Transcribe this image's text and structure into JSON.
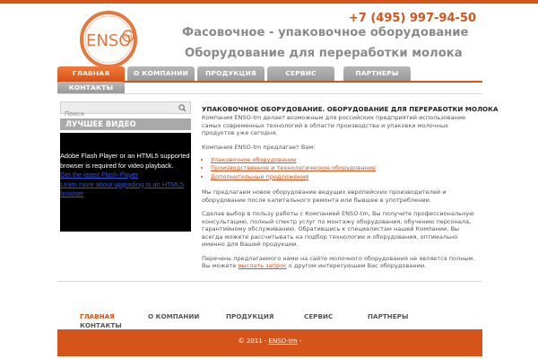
{
  "brand": {
    "logo_text": "ENSO",
    "logo_badge": "tm",
    "accent": "#d4541a"
  },
  "header": {
    "phone": "+7 (495) 997-94-50",
    "title_line1": "Фасовочное - упаковочное оборудование",
    "title_line2": "Оборудование для переработки молока"
  },
  "nav": {
    "tabs": [
      {
        "label": "Главная",
        "active": true
      },
      {
        "label": "О компании",
        "active": false
      },
      {
        "label": "Продукция",
        "active": false
      },
      {
        "label": "Сервис",
        "active": false
      },
      {
        "label": "Партнеры",
        "active": false
      },
      {
        "label": "Контакты",
        "active": false
      }
    ]
  },
  "sidebar": {
    "search_placeholder": "Поиск",
    "video_heading": "Лучшее видео",
    "video_message": "Adobe Flash Player or an HTML5 supported browser is required for video playback.",
    "video_link1": "Get the latest Flash Player",
    "video_link2": "Learn more about upgrading to an HTML5 browser"
  },
  "content": {
    "heading": "Упаковочное оборудование. Оборудование для переработки молока",
    "p1": "Компания ENSO-tm делает возможным для российских предприятий использование самых современных технологий в области производства и упаковки молочных продуктов уже сегодня.",
    "p2": "Компания ENSO-tm предлагает Вам:",
    "offers": [
      "Упаковочное оборудование",
      "Производственное и технологическое оборудование",
      "Дополнительные предложения"
    ],
    "p3": "Мы предлагаем новое оборудование ведущих европейских производителей и оборудование после капитального ремонта или бывшее в употреблении.",
    "p4": "Сделав выбор в пользу работы с Компанией ENSO-tm, Вы получите профессиональную консультацию, полный спектр услуг по монтажу оборудования, обучению персонала, гарантийному обслуживанию. Обратившись к специалистам нашей Компании, Вы всегда можете рассчитывать на подбор технологии и оборудования, оптимально именно для Вашей продукции.",
    "p5_before": "Перечень предлагаемого нами на сайте молочного оборудования не является полным. Вы можете",
    "p5_link": "выслать запрос",
    "p5_after": "о другом интересующем Вас оборудовании."
  },
  "footer_nav": {
    "items": [
      "Главная",
      "О компании",
      "Продукция",
      "Сервис",
      "Партнеры"
    ],
    "contacts": "Контакты"
  },
  "footer": {
    "copyright_prefix": "© 2011 -",
    "link": "ENSO-tm",
    "copyright_suffix": "-"
  }
}
